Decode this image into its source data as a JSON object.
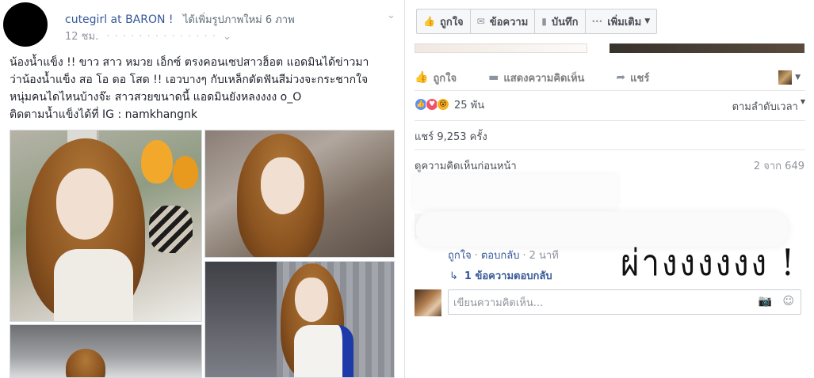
{
  "post": {
    "author": "cutegirl at BARON !",
    "action_text": "ได้เพิ่มรูปภาพใหม่ 6 ภาพ",
    "time": "12 ชม.",
    "close_glyph": "⌄",
    "body_lines": [
      "น้องน้ำแข็ง !! ขาว สาว หมวย เอ็กซ์ ตรงคอนเซปสาวฮ็อต แอดมินได้ข่าวมา",
      "ว่าน้องน้ำแข็ง สอ โอ ดอ โสด !! เอวบางๆ กับเหล็กดัดฟันสีม่วงจะกระชากใจ",
      "หนุ่มคนไดไหนบ้างจ๊ะ สาวสวยขนาดนี้ แอดมินยังหลงงงง o_O",
      "ติดตามน้ำแข็งได้ที่ IG : namkhangnk"
    ]
  },
  "top_actions": {
    "like": "ถูกใจ",
    "message": "ข้อความ",
    "save": "บันทึก",
    "more": "เพิ่มเติม"
  },
  "post_actions": {
    "like": "ถูกใจ",
    "comment": "แสดงความคิดเห็น",
    "share": "แชร์"
  },
  "reactions": {
    "count": "25 พัน",
    "sort_label": "ตามลำดับเวลา"
  },
  "shares_text": "แชร์ 9,253 ครั้ง",
  "previous_comments": {
    "label": "ดูความคิดเห็นก่อนหน้า",
    "count": "2 จาก 649"
  },
  "comment": {
    "like_link": "ถูกใจ",
    "reply_link": "ตอบกลับ",
    "time": "2 นาที",
    "replies": "1 ข้อความตอบกลับ",
    "handwritten_note": "ผ่างงงงงง !"
  },
  "composer": {
    "placeholder": "เขียนความคิดเห็น..."
  }
}
